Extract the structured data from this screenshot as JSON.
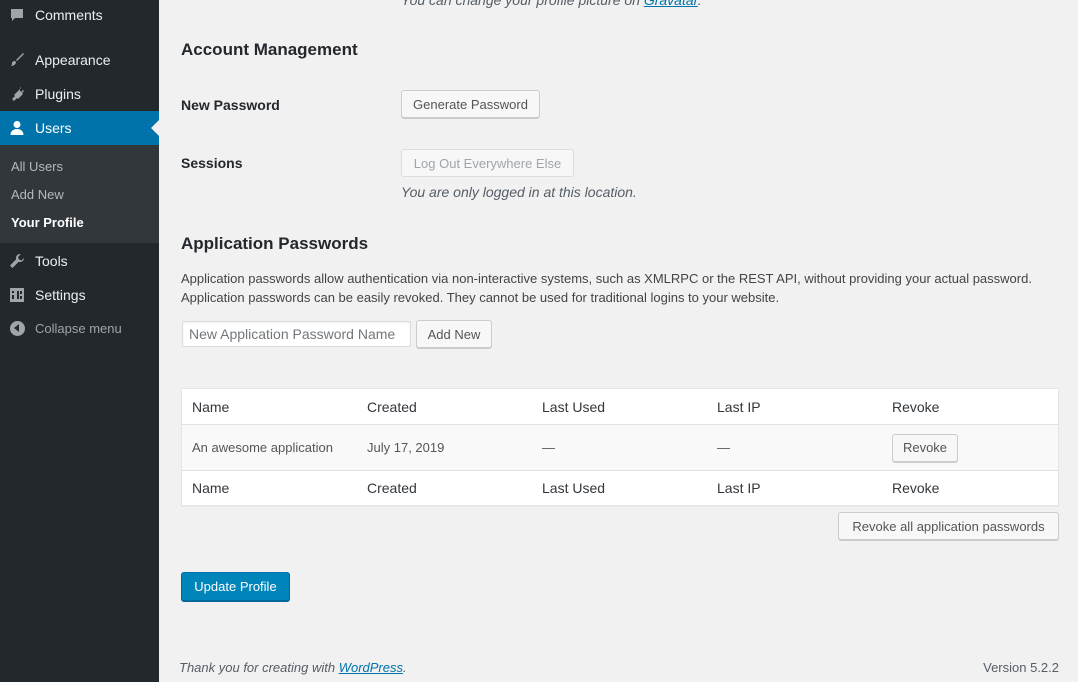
{
  "sidebar": {
    "menu": [
      {
        "label": "Comments",
        "icon": "comments-icon"
      },
      {
        "label": "Appearance",
        "icon": "appearance-brush-icon"
      },
      {
        "label": "Plugins",
        "icon": "plugins-icon"
      },
      {
        "label": "Users",
        "icon": "users-icon",
        "active": true
      },
      {
        "label": "Tools",
        "icon": "tools-wrench-icon"
      },
      {
        "label": "Settings",
        "icon": "settings-icon"
      }
    ],
    "submenu": [
      {
        "label": "All Users"
      },
      {
        "label": "Add New"
      },
      {
        "label": "Your Profile",
        "current": true
      }
    ],
    "collapse_label": "Collapse menu"
  },
  "profile_picture": {
    "text": "You can change your profile picture on ",
    "link": "Gravatar",
    "suffix": "."
  },
  "account": {
    "title": "Account Management",
    "new_password_label": "New Password",
    "generate_password_button": "Generate Password",
    "sessions_label": "Sessions",
    "logout_button": "Log Out Everywhere Else",
    "sessions_note": "You are only logged in at this location."
  },
  "app_passwords": {
    "title": "Application Passwords",
    "description": "Application passwords allow authentication via non-interactive systems, such as XMLRPC or the REST API, without providing your actual password. Application passwords can be easily revoked. They cannot be used for traditional logins to your website.",
    "name_placeholder": "New Application Password Name",
    "add_new_button": "Add New",
    "columns": [
      "Name",
      "Created",
      "Last Used",
      "Last IP",
      "Revoke"
    ],
    "rows": [
      {
        "name": "An awesome application",
        "created": "July 17, 2019",
        "last_used": "—",
        "last_ip": "—",
        "revoke_label": "Revoke"
      }
    ],
    "revoke_all_button": "Revoke all application passwords"
  },
  "update_profile_button": "Update Profile",
  "footer": {
    "thanks_text": "Thank you for creating with ",
    "thanks_link": "WordPress",
    "thanks_suffix": ".",
    "version": "Version 5.2.2"
  },
  "colors": {
    "sidebar_bg": "#23282d",
    "submenu_bg": "#32373c",
    "accent": "#0073aa",
    "primary_button": "#0085ba",
    "page_bg": "#f1f1f1"
  }
}
